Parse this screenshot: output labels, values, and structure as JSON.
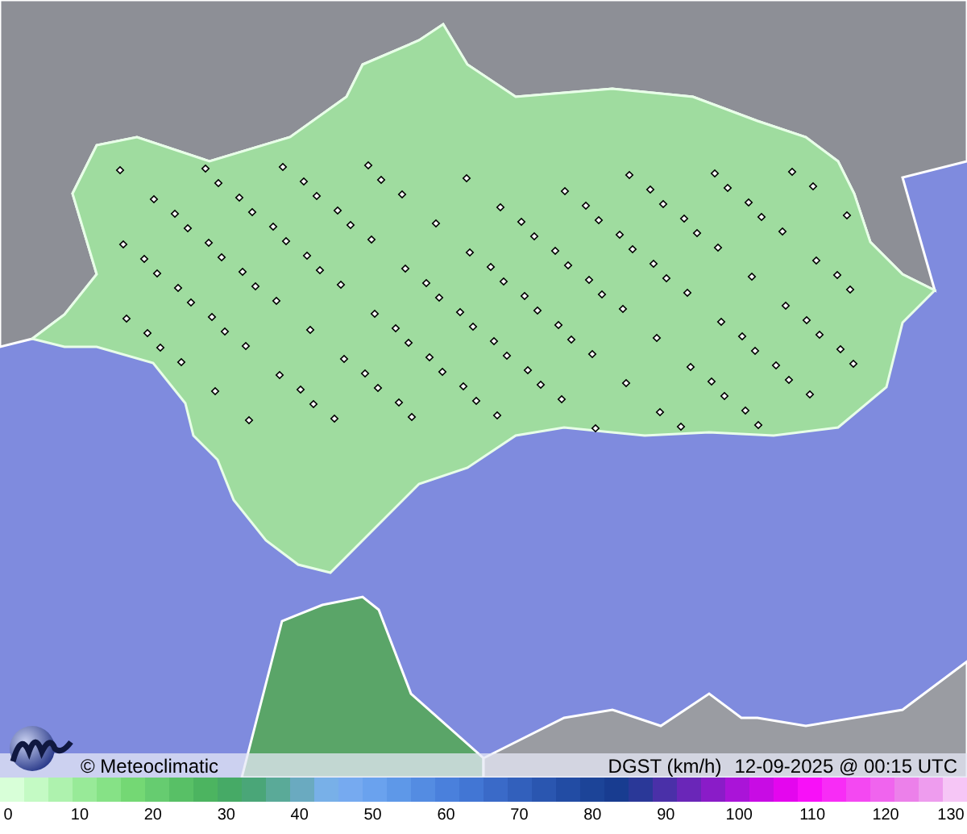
{
  "map": {
    "brand": "© Meteoclimatic",
    "variable": "DGST (km/h)",
    "timestamp": "12-09-2025 @ 00:15 UTC"
  },
  "legend": {
    "ticks": [
      "0",
      "10",
      "20",
      "30",
      "40",
      "50",
      "60",
      "70",
      "80",
      "90",
      "100",
      "110",
      "120",
      "130"
    ]
  }
}
